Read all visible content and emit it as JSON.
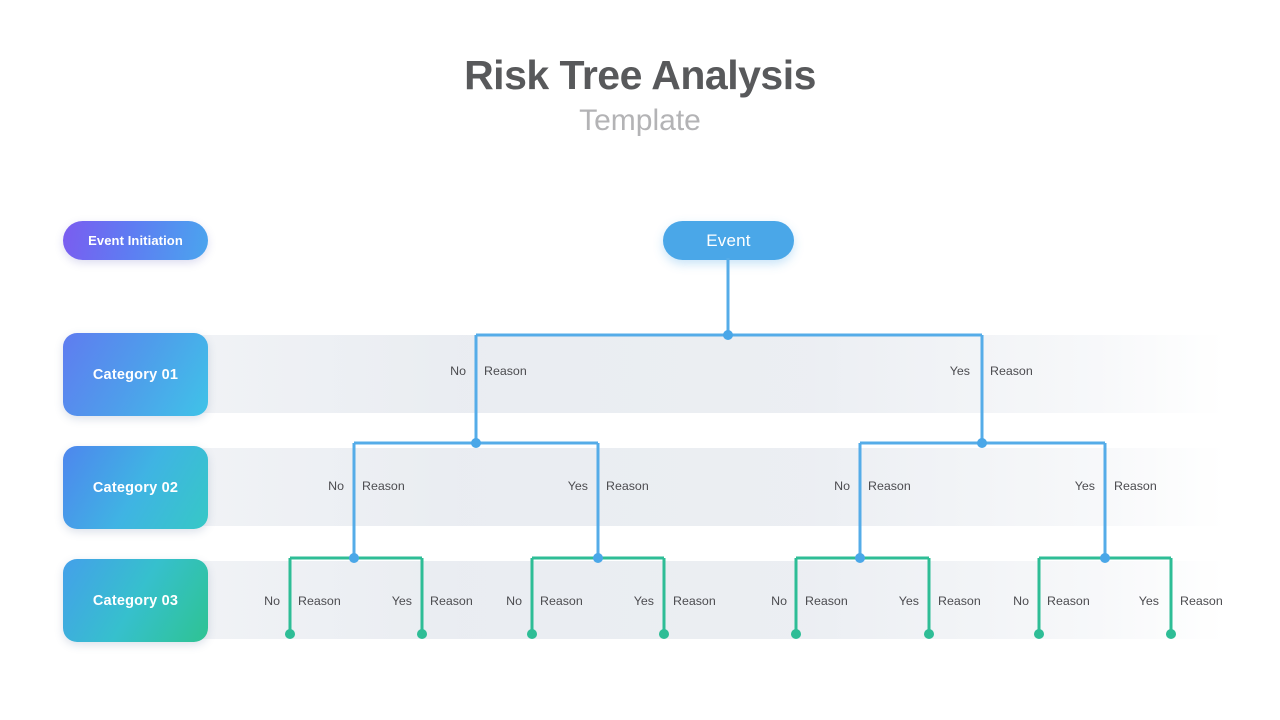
{
  "header": {
    "title": "Risk Tree Analysis",
    "subtitle": "Template"
  },
  "legend": {
    "event_initiation": "Event Initiation",
    "categories": [
      {
        "id": "cat-01",
        "label": "Category 01"
      },
      {
        "id": "cat-02",
        "label": "Category 02"
      },
      {
        "id": "cat-03",
        "label": "Category 03"
      }
    ]
  },
  "tree": {
    "root": {
      "label": "Event"
    },
    "level1": [
      {
        "branch": "no",
        "decision": "No",
        "reason": "Reason"
      },
      {
        "branch": "yes",
        "decision": "Yes",
        "reason": "Reason"
      }
    ],
    "level2": [
      {
        "branch": "no",
        "decision": "No",
        "reason": "Reason"
      },
      {
        "branch": "yes",
        "decision": "Yes",
        "reason": "Reason"
      },
      {
        "branch": "no",
        "decision": "No",
        "reason": "Reason"
      },
      {
        "branch": "yes",
        "decision": "Yes",
        "reason": "Reason"
      }
    ],
    "level3": [
      {
        "branch": "no",
        "decision": "No",
        "reason": "Reason"
      },
      {
        "branch": "yes",
        "decision": "Yes",
        "reason": "Reason"
      },
      {
        "branch": "no",
        "decision": "No",
        "reason": "Reason"
      },
      {
        "branch": "yes",
        "decision": "Yes",
        "reason": "Reason"
      },
      {
        "branch": "no",
        "decision": "No",
        "reason": "Reason"
      },
      {
        "branch": "yes",
        "decision": "Yes",
        "reason": "Reason"
      },
      {
        "branch": "no",
        "decision": "No",
        "reason": "Reason"
      },
      {
        "branch": "yes",
        "decision": "Yes",
        "reason": "Reason"
      }
    ]
  },
  "colors": {
    "title": "#58595b",
    "subtitle": "#b3b3b5",
    "event_blue": "#4aa7e8",
    "connector_blue": "#55ace8",
    "connector_green": "#2ebd96",
    "band": "#e4e8ee",
    "label_text": "#4c4c50"
  }
}
